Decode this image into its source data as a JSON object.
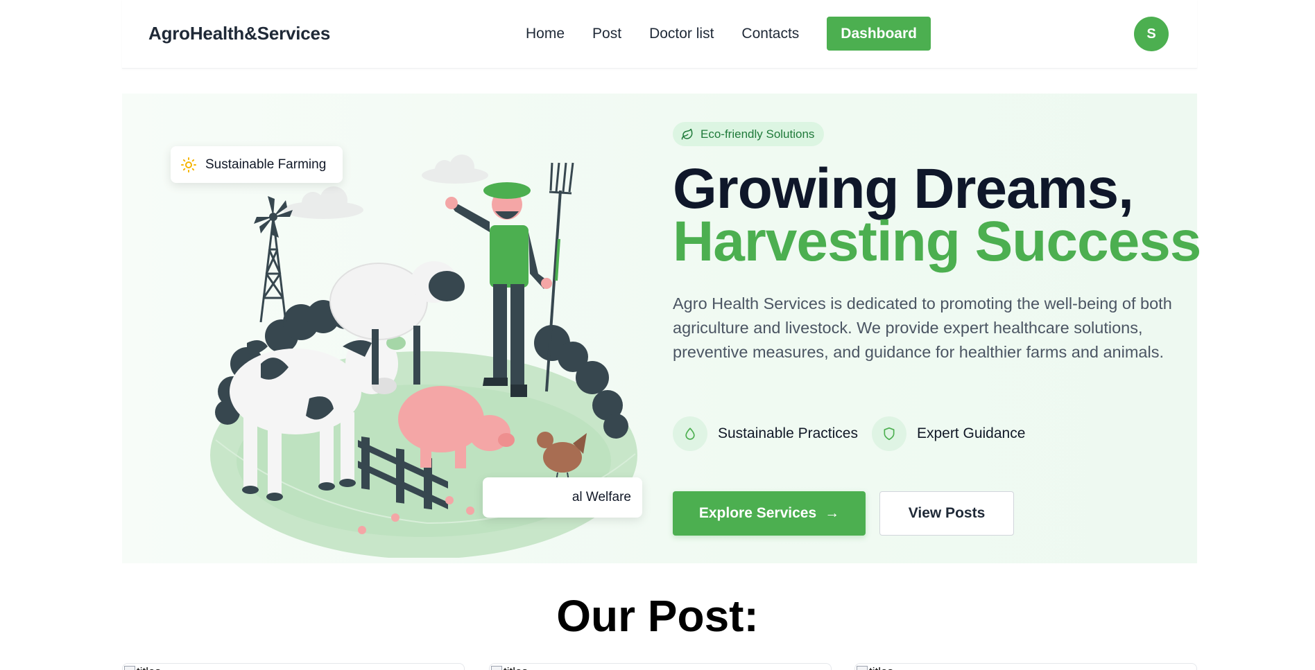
{
  "header": {
    "brand": "AgroHealth&Services",
    "nav": [
      {
        "label": "Home"
      },
      {
        "label": "Post"
      },
      {
        "label": "Doctor list"
      },
      {
        "label": "Contacts"
      }
    ],
    "dashboard_label": "Dashboard",
    "avatar_initial": "S"
  },
  "hero": {
    "badge": "Eco-friendly Solutions",
    "title_line1": "Growing Dreams,",
    "title_line2": "Harvesting Success",
    "description": "Agro Health Services is dedicated to promoting the well-being of both agriculture and livestock. We provide expert healthcare solutions, preventive measures, and guidance for healthier farms and animals.",
    "features": [
      {
        "label": "Sustainable Practices",
        "icon": "droplet-icon"
      },
      {
        "label": "Expert Guidance",
        "icon": "shield-icon"
      }
    ],
    "primary_button": "Explore Services",
    "secondary_button": "View Posts",
    "chip_top": "Sustainable Farming",
    "chip_bottom": "al Welfare"
  },
  "posts": {
    "title": "Our Post:",
    "cards": [
      {
        "img_alt": "titles"
      },
      {
        "img_alt": "titles"
      },
      {
        "img_alt": "titles"
      }
    ]
  },
  "colors": {
    "accent": "#4caf50",
    "heading": "#0f172a",
    "hero_bg": "#f0faf2"
  }
}
